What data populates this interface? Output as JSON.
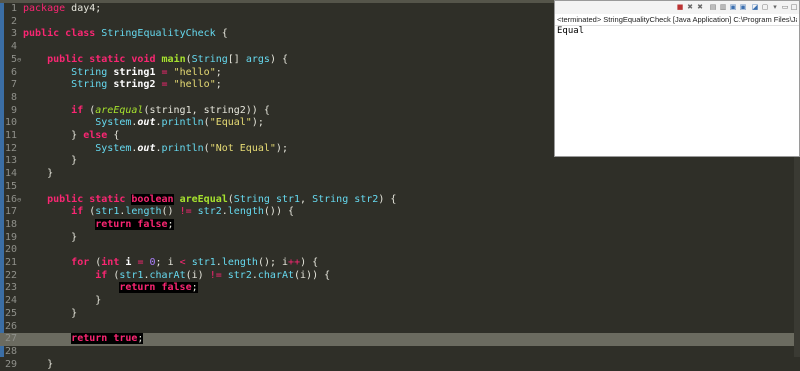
{
  "editor": {
    "package_kw": "package",
    "package_name": " day4;",
    "lines": [
      {
        "n": "1"
      },
      {
        "n": "2"
      },
      {
        "n": "3"
      },
      {
        "n": "4"
      },
      {
        "n": "5",
        "fold": "⊖"
      },
      {
        "n": "6"
      },
      {
        "n": "7"
      },
      {
        "n": "8"
      },
      {
        "n": "9"
      },
      {
        "n": "10"
      },
      {
        "n": "11"
      },
      {
        "n": "12"
      },
      {
        "n": "13"
      },
      {
        "n": "14"
      },
      {
        "n": "15"
      },
      {
        "n": "16",
        "fold": "⊖"
      },
      {
        "n": "17"
      },
      {
        "n": "18"
      },
      {
        "n": "19"
      },
      {
        "n": "20"
      },
      {
        "n": "21"
      },
      {
        "n": "22"
      },
      {
        "n": "23"
      },
      {
        "n": "24"
      },
      {
        "n": "25"
      },
      {
        "n": "26"
      },
      {
        "n": "27"
      },
      {
        "n": "28"
      },
      {
        "n": "29"
      }
    ],
    "class_name": "StringEqualityCheck",
    "main_method": "main",
    "string_type": "String",
    "args": "args",
    "var1": "string1",
    "var2": "string2",
    "hello": "\"hello\"",
    "method_name": "areEqual",
    "equal_str": "\"Equal\"",
    "not_equal_str": "\"Not Equal\"",
    "system": "System",
    "out": "out",
    "println": "println",
    "str1": "str1",
    "str2": "str2",
    "length": "length",
    "charAt": "charAt",
    "zero": "0",
    "i": "i"
  },
  "console": {
    "status": "<terminated> StringEqualityCheck [Java Application] C:\\Program Files\\Ja",
    "output": "Equal",
    "toolbar_icons": [
      "stop-icon",
      "remove-icon",
      "remove-all-icon",
      "scroll-lock-icon",
      "pin-icon",
      "display-icon",
      "open-console-icon",
      "minimize-icon",
      "maximize-icon"
    ]
  }
}
